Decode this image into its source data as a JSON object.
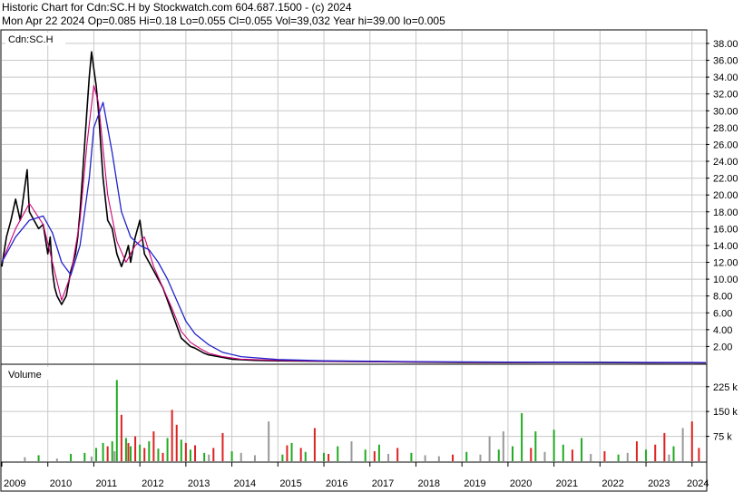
{
  "header": {
    "line1": "Historic Chart for Cdn:SC.H by Stockwatch.com 604.687.1500 - (c) 2024",
    "line2": "Mon Apr 22 2024   Op=0.085   Hi=0.18   Lo=0.055   Cl=0.055   Vol=39,032   Year hi=39.00   lo=0.005"
  },
  "colors": {
    "price": "#000000",
    "ma_short": "#d0007a",
    "ma_long": "#2222cc",
    "vol_up": "#22aa22",
    "vol_down": "#dd2222",
    "vol_flat": "#999999",
    "grid": "#c8c8c8"
  },
  "chart_data": [
    {
      "type": "line",
      "title": "Cdn:SC.H",
      "ylim": [
        0,
        39.5
      ],
      "yticks": [
        2,
        4,
        6,
        8,
        10,
        12,
        14,
        16,
        18,
        20,
        22,
        24,
        26,
        28,
        30,
        32,
        34,
        36,
        38
      ],
      "ytick_labels": [
        "2.00",
        "4.00",
        "6.00",
        "8.00",
        "10.00",
        "12.00",
        "14.00",
        "16.00",
        "18.00",
        "20.00",
        "22.00",
        "24.00",
        "26.00",
        "28.00",
        "30.00",
        "32.00",
        "34.00",
        "36.00",
        "38.00"
      ],
      "xlim": [
        2009.0,
        2024.3
      ],
      "grid": true,
      "series": [
        {
          "role": "price",
          "x": [
            2009.0,
            2009.1,
            2009.2,
            2009.3,
            2009.4,
            2009.5,
            2009.55,
            2009.6,
            2009.7,
            2009.8,
            2009.9,
            2010.0,
            2010.05,
            2010.1,
            2010.15,
            2010.2,
            2010.3,
            2010.4,
            2010.5,
            2010.6,
            2010.65,
            2010.7,
            2010.75,
            2010.8,
            2010.85,
            2010.9,
            2010.95,
            2011.0,
            2011.05,
            2011.1,
            2011.15,
            2011.2,
            2011.3,
            2011.4,
            2011.5,
            2011.6,
            2011.7,
            2011.75,
            2011.8,
            2011.85,
            2011.9,
            2012.0,
            2012.1,
            2012.2,
            2012.3,
            2012.4,
            2012.5,
            2012.6,
            2012.7,
            2012.8,
            2012.9,
            2013.0,
            2013.1,
            2013.2,
            2013.3,
            2013.4,
            2013.5,
            2013.6,
            2013.8,
            2014.0,
            2014.5,
            2015.0,
            2016.0,
            2017.0,
            2018.0,
            2019.0,
            2020.0,
            2021.0,
            2022.0,
            2023.0,
            2024.0,
            2024.3
          ],
          "values": [
            11.5,
            15.0,
            17.0,
            19.5,
            17.0,
            21.0,
            23.0,
            18.0,
            17.0,
            16.0,
            16.5,
            13.0,
            15.0,
            11.0,
            9.0,
            8.0,
            7.0,
            8.0,
            11.0,
            13.0,
            15.0,
            18.0,
            22.0,
            26.0,
            30.0,
            34.0,
            37.0,
            35.0,
            33.0,
            30.0,
            26.0,
            22.0,
            17.0,
            16.0,
            13.0,
            11.5,
            13.0,
            14.0,
            12.0,
            13.5,
            15.0,
            17.0,
            13.0,
            12.0,
            11.0,
            10.0,
            9.0,
            7.5,
            6.0,
            4.5,
            3.0,
            2.5,
            2.0,
            1.8,
            1.5,
            1.2,
            1.0,
            0.9,
            0.7,
            0.5,
            0.35,
            0.3,
            0.25,
            0.2,
            0.15,
            0.12,
            0.1,
            0.12,
            0.1,
            0.08,
            0.07,
            0.055
          ]
        },
        {
          "role": "ma_short",
          "x": [
            2009.0,
            2009.3,
            2009.6,
            2009.9,
            2010.1,
            2010.3,
            2010.5,
            2010.7,
            2010.85,
            2011.0,
            2011.1,
            2011.3,
            2011.5,
            2011.7,
            2011.9,
            2012.1,
            2012.3,
            2012.5,
            2012.7,
            2012.9,
            2013.1,
            2013.3,
            2013.5,
            2013.8,
            2014.2,
            2015.0,
            2016.0,
            2018.0,
            2020.0,
            2022.0,
            2024.3
          ],
          "values": [
            12.0,
            16.0,
            19.0,
            16.5,
            12.0,
            7.5,
            10.5,
            17.0,
            26.0,
            33.0,
            31.0,
            20.0,
            14.5,
            12.0,
            14.0,
            15.0,
            11.5,
            9.0,
            6.5,
            3.8,
            2.5,
            1.8,
            1.2,
            0.8,
            0.5,
            0.35,
            0.25,
            0.15,
            0.12,
            0.1,
            0.07
          ]
        },
        {
          "role": "ma_long",
          "x": [
            2009.0,
            2009.3,
            2009.6,
            2009.9,
            2010.1,
            2010.3,
            2010.5,
            2010.7,
            2010.9,
            2011.0,
            2011.2,
            2011.4,
            2011.6,
            2011.8,
            2012.0,
            2012.2,
            2012.4,
            2012.6,
            2012.8,
            2013.0,
            2013.2,
            2013.5,
            2013.8,
            2014.2,
            2015.0,
            2016.0,
            2018.0,
            2020.0,
            2022.0,
            2024.3
          ],
          "values": [
            12.0,
            15.0,
            17.0,
            17.5,
            15.5,
            12.0,
            10.5,
            14.0,
            22.0,
            28.0,
            31.0,
            25.0,
            18.0,
            15.0,
            14.0,
            13.5,
            12.0,
            10.0,
            7.5,
            5.0,
            3.5,
            2.2,
            1.3,
            0.8,
            0.45,
            0.3,
            0.2,
            0.15,
            0.12,
            0.1
          ]
        }
      ]
    },
    {
      "type": "bar",
      "title": "Volume",
      "ylim": [
        0,
        290
      ],
      "yticks": [
        75,
        150,
        225
      ],
      "ytick_labels": [
        "75 k",
        "150 k",
        "225 k"
      ],
      "xticks": [
        2009,
        2010,
        2011,
        2012,
        2013,
        2014,
        2015,
        2016,
        2017,
        2018,
        2019,
        2020,
        2021,
        2022,
        2023,
        2024
      ],
      "xtick_labels": [
        "2009",
        "2010",
        "2011",
        "2012",
        "2013",
        "2014",
        "2015",
        "2016",
        "2017",
        "2018",
        "2019",
        "2020",
        "2021",
        "2022",
        "2023",
        "2024"
      ],
      "units": "k",
      "series": [
        {
          "name": "Volume",
          "x": [
            2009.5,
            2009.8,
            2010.2,
            2010.5,
            2010.8,
            2010.95,
            2011.05,
            2011.2,
            2011.3,
            2011.4,
            2011.45,
            2011.5,
            2011.6,
            2011.7,
            2011.75,
            2011.8,
            2011.9,
            2012.0,
            2012.1,
            2012.2,
            2012.3,
            2012.4,
            2012.5,
            2012.6,
            2012.7,
            2012.8,
            2012.9,
            2013.0,
            2013.1,
            2013.2,
            2013.4,
            2013.5,
            2013.6,
            2013.8,
            2014.0,
            2014.2,
            2014.5,
            2014.8,
            2015.1,
            2015.2,
            2015.3,
            2015.5,
            2015.6,
            2015.8,
            2016.0,
            2016.1,
            2016.3,
            2016.6,
            2016.9,
            2017.1,
            2017.2,
            2017.4,
            2017.6,
            2017.9,
            2018.2,
            2018.5,
            2018.8,
            2019.1,
            2019.4,
            2019.6,
            2019.8,
            2019.9,
            2020.1,
            2020.3,
            2020.5,
            2020.6,
            2020.8,
            2021.0,
            2021.2,
            2021.4,
            2021.6,
            2021.8,
            2022.1,
            2022.4,
            2022.6,
            2022.8,
            2023.0,
            2023.2,
            2023.4,
            2023.5,
            2023.6,
            2023.8,
            2024.0,
            2024.15
          ],
          "values": [
            12,
            18,
            8,
            22,
            25,
            14,
            40,
            55,
            45,
            60,
            30,
            245,
            140,
            70,
            55,
            45,
            75,
            50,
            40,
            60,
            90,
            38,
            25,
            70,
            155,
            110,
            65,
            55,
            35,
            48,
            25,
            20,
            40,
            85,
            30,
            25,
            18,
            120,
            20,
            48,
            55,
            40,
            28,
            100,
            25,
            22,
            45,
            60,
            35,
            30,
            50,
            22,
            40,
            25,
            18,
            15,
            20,
            28,
            20,
            75,
            35,
            90,
            45,
            145,
            40,
            90,
            28,
            95,
            50,
            35,
            70,
            22,
            30,
            20,
            25,
            60,
            35,
            50,
            85,
            20,
            45,
            100,
            120,
            40
          ],
          "dir": [
            0,
            1,
            0,
            1,
            1,
            0,
            1,
            1,
            2,
            1,
            0,
            1,
            2,
            1,
            2,
            1,
            2,
            1,
            2,
            1,
            2,
            1,
            2,
            1,
            2,
            2,
            1,
            2,
            1,
            2,
            1,
            0,
            2,
            2,
            1,
            0,
            0,
            0,
            1,
            2,
            1,
            2,
            1,
            2,
            1,
            2,
            1,
            0,
            1,
            2,
            1,
            0,
            2,
            1,
            0,
            0,
            2,
            1,
            0,
            0,
            1,
            0,
            1,
            1,
            2,
            1,
            0,
            1,
            1,
            2,
            1,
            0,
            2,
            1,
            0,
            2,
            1,
            2,
            2,
            0,
            1,
            0,
            2,
            2
          ]
        }
      ]
    }
  ]
}
